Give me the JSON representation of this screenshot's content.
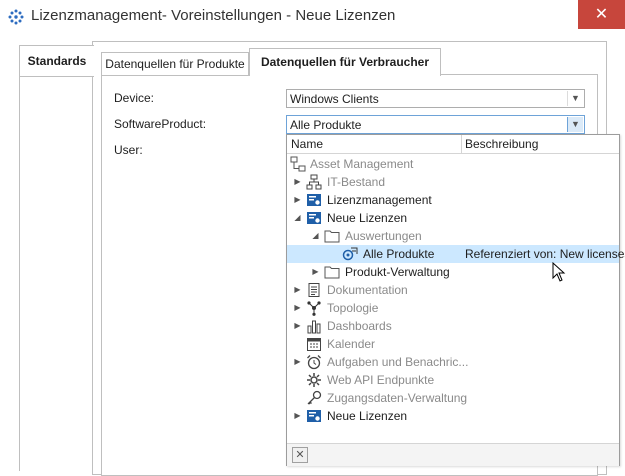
{
  "window": {
    "title": "Lizenzmanagement- Voreinstellungen - Neue Lizenzen",
    "close_glyph": "✕"
  },
  "nav": {
    "tab_label": "Standards"
  },
  "tabs": [
    {
      "label": "Datenquellen für Produkte",
      "selected": false
    },
    {
      "label": "Datenquellen für Verbraucher",
      "selected": true
    }
  ],
  "form": {
    "device_label": "Device:",
    "device_value": "Windows Clients",
    "software_label": "SoftwareProduct:",
    "software_value": "Alle Produkte",
    "user_label": "User:"
  },
  "dropdown": {
    "columns": [
      "Name",
      "Beschreibung"
    ],
    "rows": [
      {
        "label": "Asset Management",
        "description": "",
        "icon": "asset-management-icon",
        "expander": "",
        "level": 0,
        "muted": true
      },
      {
        "label": "IT-Bestand",
        "description": "",
        "icon": "network-icon",
        "expander": "▶",
        "level": 1,
        "muted": true
      },
      {
        "label": "Lizenzmanagement",
        "description": "",
        "icon": "license-module-icon",
        "expander": "▶",
        "level": 1,
        "muted": false
      },
      {
        "label": "Neue Lizenzen",
        "description": "",
        "icon": "license-module-icon",
        "expander": "◢",
        "level": 1,
        "muted": false
      },
      {
        "label": "Auswertungen",
        "description": "",
        "icon": "folder-icon",
        "expander": "◢",
        "level": 2,
        "muted": true
      },
      {
        "label": "Alle Produkte",
        "description": "Referenziert von: New licenses",
        "icon": "product-query-icon",
        "expander": "",
        "level": 3,
        "muted": false,
        "selected": true
      },
      {
        "label": "Produkt-Verwaltung",
        "description": "",
        "icon": "folder-icon",
        "expander": "▶",
        "level": 2,
        "muted": false
      },
      {
        "label": "Dokumentation",
        "description": "",
        "icon": "document-icon",
        "expander": "▶",
        "level": 1,
        "muted": true
      },
      {
        "label": "Topologie",
        "description": "",
        "icon": "topology-icon",
        "expander": "▶",
        "level": 1,
        "muted": true
      },
      {
        "label": "Dashboards",
        "description": "",
        "icon": "chart-icon",
        "expander": "▶",
        "level": 1,
        "muted": true
      },
      {
        "label": "Kalender",
        "description": "",
        "icon": "calendar-icon",
        "expander": "",
        "level": 1,
        "muted": true
      },
      {
        "label": "Aufgaben und Benachric...",
        "description": "",
        "icon": "alarm-clock-icon",
        "expander": "▶",
        "level": 1,
        "muted": true
      },
      {
        "label": "Web API Endpunkte",
        "description": "",
        "icon": "web-api-icon",
        "expander": "",
        "level": 1,
        "muted": true
      },
      {
        "label": "Zugangsdaten-Verwaltung",
        "description": "",
        "icon": "key-icon",
        "expander": "",
        "level": 1,
        "muted": true
      },
      {
        "label": "Neue Lizenzen",
        "description": "",
        "icon": "license-module-icon",
        "expander": "▶",
        "level": 1,
        "muted": false
      }
    ],
    "footer_clear_glyph": "✕"
  },
  "colors": {
    "close_button": "#c7463c",
    "selection": "#cce8ff",
    "muted_text": "#8a8a8a",
    "license_icon": "#1f5fa8"
  }
}
